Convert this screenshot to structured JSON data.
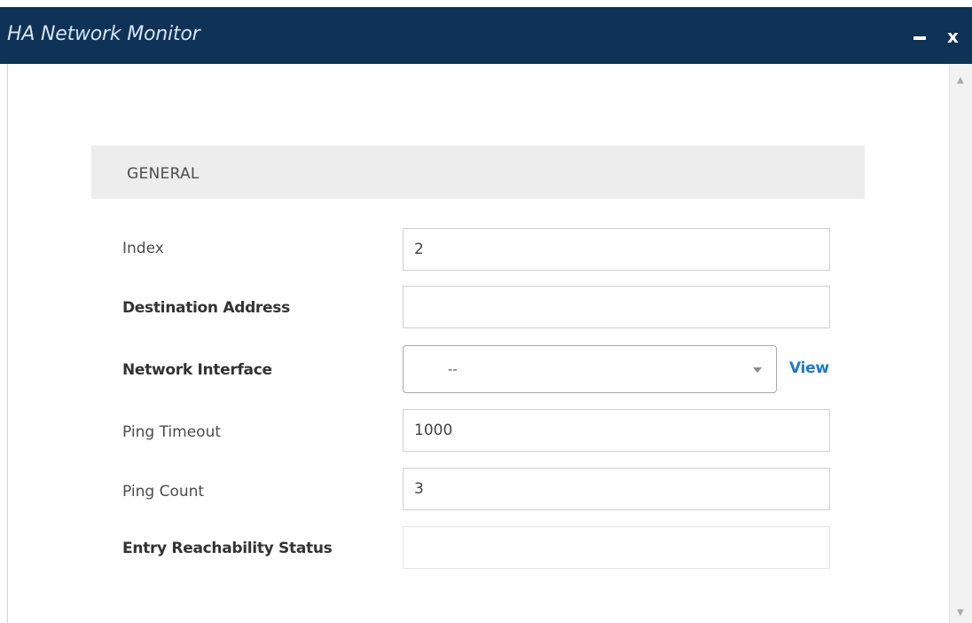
{
  "window": {
    "title": "HA Network Monitor",
    "minimize_icon": "minimize-icon",
    "close_label": "x"
  },
  "section": {
    "title": "GENERAL"
  },
  "fields": {
    "index": {
      "label": "Index",
      "value": "2"
    },
    "destination_address": {
      "label": "Destination Address",
      "value": ""
    },
    "network_interface": {
      "label": "Network Interface",
      "value": "--",
      "link": "View"
    },
    "ping_timeout": {
      "label": "Ping Timeout",
      "value": "1000"
    },
    "ping_count": {
      "label": "Ping Count",
      "value": "3"
    },
    "entry_reachability_status": {
      "label": "Entry Reachability Status",
      "value": ""
    }
  },
  "colors": {
    "titlebar": "#0f3257",
    "title_text": "#d6e4f3",
    "section_bg": "#ededed",
    "link": "#1e78c8"
  }
}
